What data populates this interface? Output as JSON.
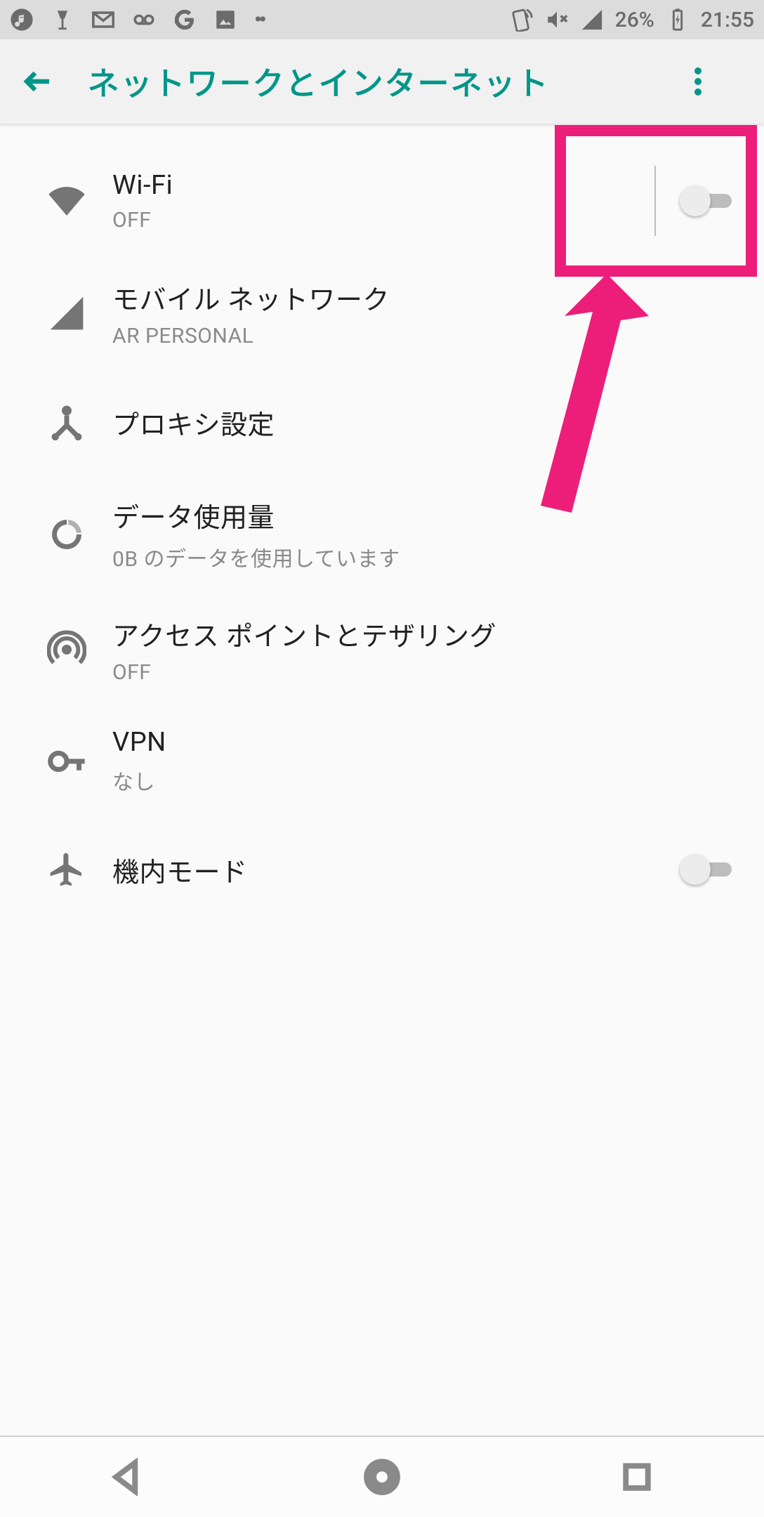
{
  "status": {
    "battery_pct": "26%",
    "clock": "21:55"
  },
  "appbar": {
    "title": "ネットワークとインターネット"
  },
  "settings": {
    "wifi": {
      "title": "Wi-Fi",
      "sub": "OFF"
    },
    "mobile": {
      "title": "モバイル ネットワーク",
      "sub": "AR PERSONAL"
    },
    "proxy": {
      "title": "プロキシ設定"
    },
    "data": {
      "title": "データ使用量",
      "sub": "0B のデータを使用しています"
    },
    "hotspot": {
      "title": "アクセス ポイントとテザリング",
      "sub": "OFF"
    },
    "vpn": {
      "title": "VPN",
      "sub": "なし"
    },
    "airplane": {
      "title": "機内モード"
    }
  }
}
